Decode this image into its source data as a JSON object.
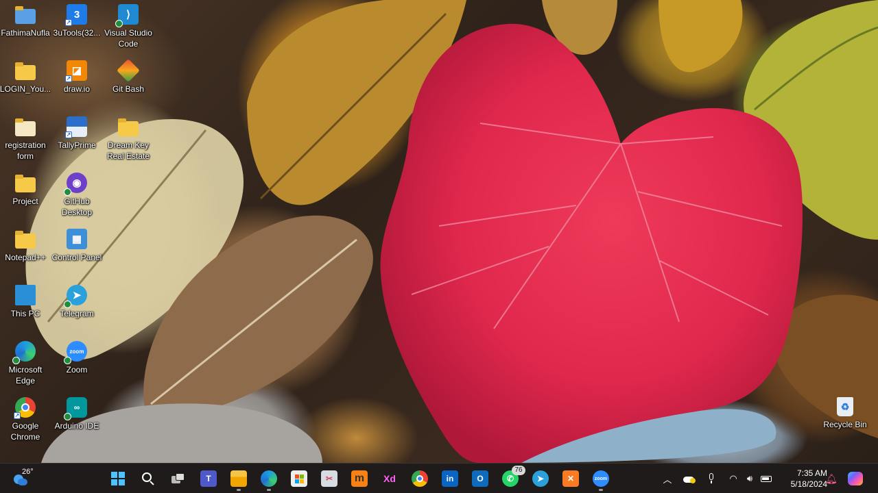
{
  "desktop": {
    "icons": [
      {
        "label": "FathimaNufla",
        "icon": "user-folder-icon"
      },
      {
        "label": "3uTools(32...",
        "icon": "3utools-icon"
      },
      {
        "label": "Visual Studio Code",
        "icon": "vscode-icon"
      },
      {
        "label": "LOGIN_You...",
        "icon": "folder-icon"
      },
      {
        "label": "draw.io",
        "icon": "drawio-icon"
      },
      {
        "label": "Git Bash",
        "icon": "git-bash-icon"
      },
      {
        "label": "registration form",
        "icon": "folder-icon"
      },
      {
        "label": "TallyPrime",
        "icon": "tallyprime-icon"
      },
      {
        "label": "Dream Key Real Estate",
        "icon": "folder-icon"
      },
      {
        "label": "Project",
        "icon": "folder-icon"
      },
      {
        "label": "GitHub Desktop",
        "icon": "github-desktop-icon"
      },
      {
        "label": "Notepad++",
        "icon": "notepad-plus-plus-icon"
      },
      {
        "label": "Control Panel",
        "icon": "control-panel-icon"
      },
      {
        "label": "This PC",
        "icon": "this-pc-icon"
      },
      {
        "label": "Telegram",
        "icon": "telegram-icon"
      },
      {
        "label": "Microsoft Edge",
        "icon": "edge-icon"
      },
      {
        "label": "Zoom",
        "icon": "zoom-icon"
      },
      {
        "label": "Google Chrome",
        "icon": "chrome-icon"
      },
      {
        "label": "Arduino IDE",
        "icon": "arduino-icon"
      },
      {
        "label": "Recycle Bin",
        "icon": "recycle-bin-icon"
      }
    ]
  },
  "taskbar": {
    "weather": {
      "temp": "26°",
      "icon": "weather-icon"
    },
    "apps": [
      {
        "name": "Start",
        "icon": "windows-start-icon"
      },
      {
        "name": "Search",
        "icon": "search-icon"
      },
      {
        "name": "Task View",
        "icon": "task-view-icon"
      },
      {
        "name": "Microsoft Teams",
        "icon": "teams-icon"
      },
      {
        "name": "File Explorer",
        "icon": "file-explorer-icon"
      },
      {
        "name": "Microsoft Edge",
        "icon": "edge-icon"
      },
      {
        "name": "Microsoft Store",
        "icon": "store-icon"
      },
      {
        "name": "Snipping Tool",
        "icon": "snipping-tool-icon"
      },
      {
        "name": "Moodle",
        "icon": "moodle-icon",
        "glyph": "m"
      },
      {
        "name": "Adobe XD",
        "icon": "adobe-xd-icon",
        "glyph": "Xd"
      },
      {
        "name": "Google Chrome",
        "icon": "chrome-icon"
      },
      {
        "name": "LinkedIn",
        "icon": "linkedin-icon",
        "glyph": "in"
      },
      {
        "name": "Outlook (new)",
        "icon": "outlook-icon",
        "glyph": "O"
      },
      {
        "name": "WhatsApp",
        "icon": "whatsapp-icon",
        "badge": "76"
      },
      {
        "name": "Telegram",
        "icon": "telegram-icon"
      },
      {
        "name": "XAMPP",
        "icon": "xampp-icon"
      },
      {
        "name": "Zoom",
        "icon": "zoom-icon",
        "glyph": "zoom"
      }
    ],
    "tray": {
      "overflow_icon": "chevron-up-icon",
      "onedrive_icon": "onedrive-icon",
      "mic_icon": "microphone-icon",
      "wifi_icon": "wifi-icon",
      "volume_icon": "volume-icon",
      "battery_icon": "battery-icon",
      "time": "7:35 AM",
      "date": "5/18/2024",
      "notification_icon": "notification-bell-icon",
      "copilot_icon": "copilot-icon"
    }
  },
  "colors": {
    "taskbar_bg": "#1f1b1a",
    "accent": "#0078d4",
    "red_leaf": "#e2264a"
  }
}
